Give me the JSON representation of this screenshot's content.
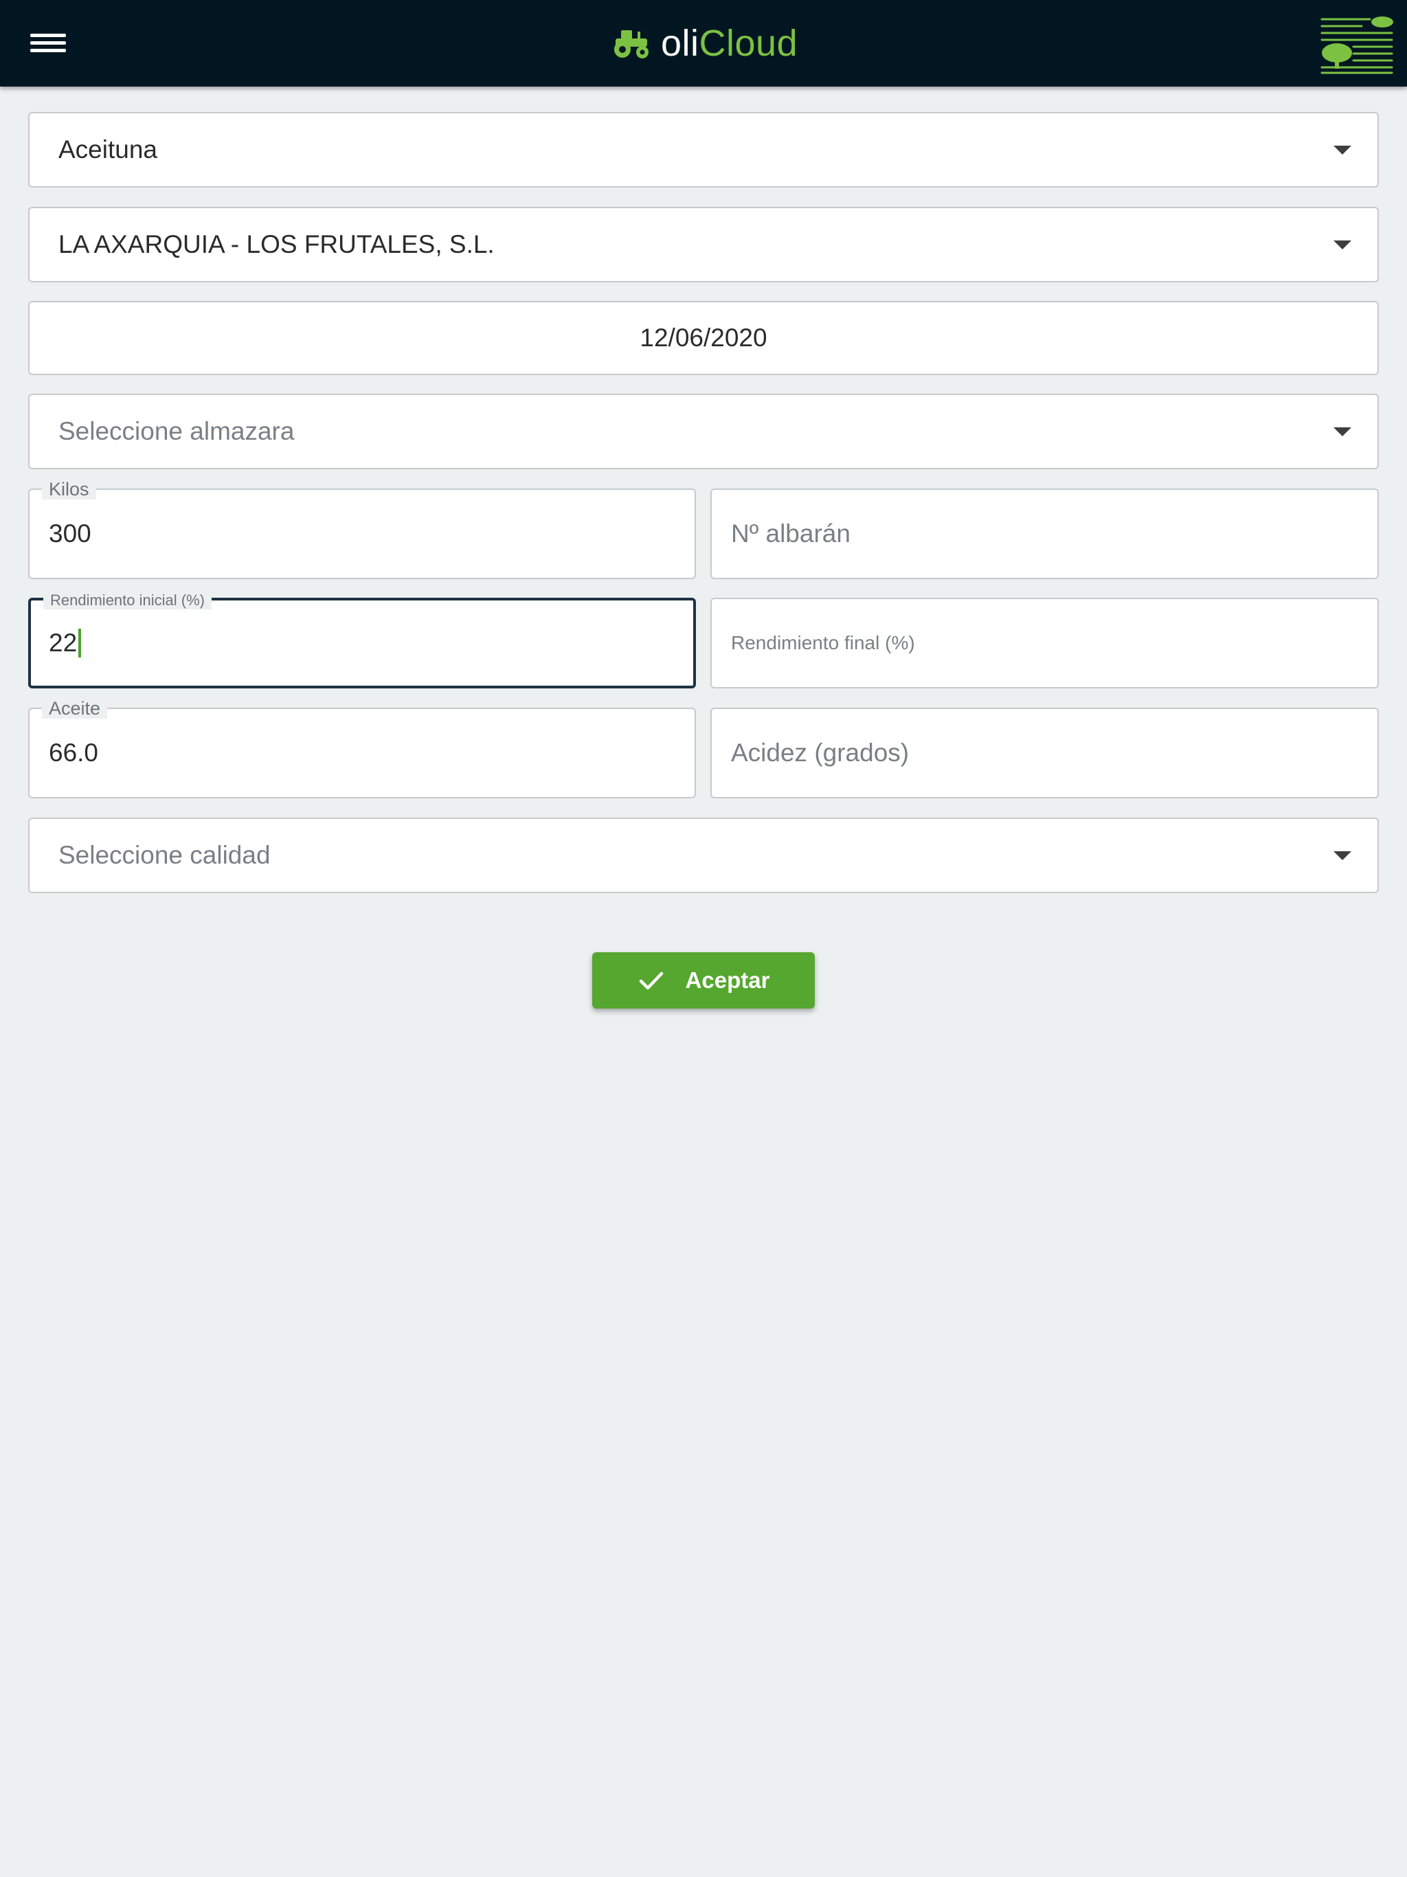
{
  "header": {
    "menu_icon": "hamburger-menu-icon",
    "brand_icon": "tractor-icon",
    "brand_part1": "oli",
    "brand_part2": "Cloud",
    "brand_mark_icon": "olive-tree-field-icon",
    "colors": {
      "background": "#021621",
      "brand_green": "#7cc142"
    }
  },
  "form": {
    "product": {
      "value": "Aceituna"
    },
    "company": {
      "value": "LA AXARQUIA - LOS FRUTALES, S.L."
    },
    "date": {
      "value": "12/06/2020"
    },
    "mill": {
      "placeholder": "Seleccione almazara"
    },
    "kilos": {
      "label": "Kilos",
      "value": "300"
    },
    "delivery_note": {
      "placeholder": "Nº albarán"
    },
    "initial_yield": {
      "label": "Rendimiento inicial (%)",
      "value": "22"
    },
    "final_yield": {
      "placeholder": "Rendimiento final (%)"
    },
    "oil": {
      "label": "Aceite",
      "value": "66.0"
    },
    "acidity": {
      "placeholder": "Acidez (grados)"
    },
    "quality": {
      "placeholder": "Seleccione calidad"
    }
  },
  "actions": {
    "accept_label": "Aceptar",
    "accept_icon": "check-icon",
    "accept_color": "#55a72f"
  }
}
